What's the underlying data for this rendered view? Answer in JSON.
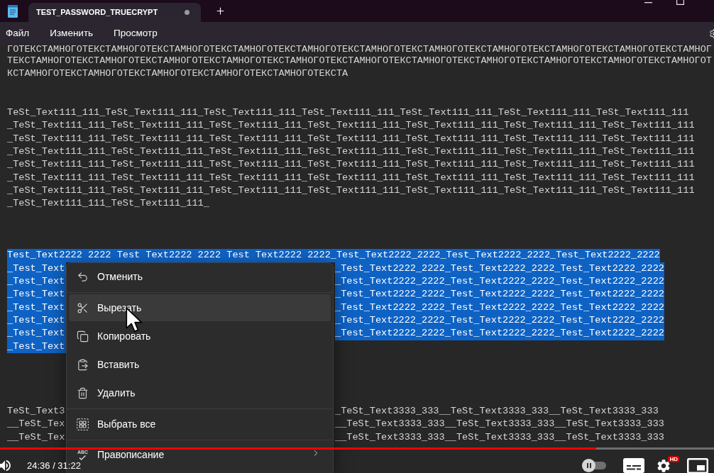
{
  "window": {
    "tab_title": "TEST_PASSWORD_TRUECRYPT",
    "modified": true
  },
  "menu_bar": {
    "items": [
      "Файл",
      "Изменить",
      "Просмотр"
    ]
  },
  "editor": {
    "blocks": [
      {
        "selected": false,
        "lines": [
          {
            "text": "ГОТЕКСТАМНОГОТЕКСТАМНОГОТЕКСТАМНОГОТЕКСТАМНОГОТЕКСТАМНОГОТЕКСТАМНОГОТЕКСТАМНОГОТЕКСТАМНОГОТЕКСТАМНОГОТЕКСТАМНОГОТЕКСТАМНОГ"
          },
          {
            "text": "ТЕКСТАМНОГОТЕКСТАМНОГОТЕКСТАМНОГОТЕКСТАМНОГОТЕКСТАМНОГОТЕКСТАМНОГОТЕКСТАМНОГОТЕКСТАМНОГОТЕКСТАМНОГОТЕКСТАМНОГОТЕКСТАМНОГОТ"
          },
          {
            "text": "КСТАМНОГОТЕКСТАМНОГОТЕКСТАМНОГОТЕКСТАМНОГОТЕКСТАМНОГОТЕКСТА"
          }
        ]
      },
      {
        "selected": false,
        "lines": [
          {
            "text": "TeSt_Text111_111_TeSt_Text111_111_TeSt_Text111_111_TeSt_Text111_111_TeSt_Text111_111_TeSt_Text111_111_TeSt_Text111_111"
          },
          {
            "text": "_TeSt_Text111_111_TeSt_Text111_111_TeSt_Text111_111_TeSt_Text111_111_TeSt_Text111_111_TeSt_Text111_111_TeSt_Text111_111"
          },
          {
            "text": "_TeSt_Text111_111_TeSt_Text111_111_TeSt_Text111_111_TeSt_Text111_111_TeSt_Text111_111_TeSt_Text111_111_TeSt_Text111_111"
          },
          {
            "text": "_TeSt_Text111_111_TeSt_Text111_111_TeSt_Text111_111_TeSt_Text111_111_TeSt_Text111_111_TeSt_Text111_111_TeSt_Text111_111"
          },
          {
            "text": "_TeSt_Text111_111_TeSt_Text111_111_TeSt_Text111_111_TeSt_Text111_111_TeSt_Text111_111_TeSt_Text111_111_TeSt_Text111_111"
          },
          {
            "text": "_TeSt_Text111_111_TeSt_Text111_111_TeSt_Text111_111_TeSt_Text111_111_TeSt_Text111_111_TeSt_Text111_111_TeSt_Text111_111"
          },
          {
            "text": "_TeSt_Text111_111_TeSt_Text111_111_TeSt_Text111_111_TeSt_Text111_111_TeSt_Text111_111_TeSt_Text111_111_TeSt_Text111_111"
          },
          {
            "text": "_TeSt_Text111_111_TeSt_Text111_111_"
          }
        ]
      },
      {
        "selected": true,
        "lines": [
          {
            "text": "Test_Text2222 2222 Test Text2222 2222 Test Text2222 2222_Test_Text2222_2222_Test_Text2222_2222_Test_Text2222_2222"
          },
          {
            "left": "_Test_Text",
            "right": "_Test_Text2222_2222_Test_Text2222_2222_Test_Text2222_2222"
          },
          {
            "left": "_Test_Text",
            "right": "_Test_Text2222_2222_Test_Text2222_2222_Test_Text2222_2222"
          },
          {
            "left": "_Test_Text",
            "right": "_Test_Text2222_2222_Test_Text2222_2222_Test_Text2222_2222"
          },
          {
            "left": "_Test_Text",
            "right": "_Test_Text2222_2222_Test_Text2222_2222_Test_Text2222_2222"
          },
          {
            "left": "_Test_Text",
            "right": "_Test_Text2222_2222_Test_Text2222_2222_Test_Text2222_2222"
          },
          {
            "left": "_Test_Text",
            "right": "_Test_Text2222_2222_Test_Text2222_2222_Test_Text2222_2222"
          },
          {
            "left": "_Test_Text"
          }
        ]
      },
      {
        "selected": false,
        "lines": [
          {
            "left": "TeSt_Text3",
            "right": "_TeSt_Text3333_333__TeSt_Text3333_333__TeSt_Text3333_333"
          },
          {
            "left": "__TeSt_Tex",
            "right": "__TeSt_Text3333_333__TeSt_Text3333_333__TeSt_Text3333_333"
          },
          {
            "left": "__TeSt_Tex",
            "right": "__TeSt_Text3333_333__TeSt_Text3333_333__TeSt_Text3333_333"
          }
        ]
      }
    ]
  },
  "context_menu": {
    "groups": [
      {
        "items": [
          {
            "label": "Отменить",
            "hovered": false,
            "submenu": false
          }
        ]
      },
      {
        "items": [
          {
            "label": "Вырезать",
            "hovered": true,
            "submenu": false
          },
          {
            "label": "Копировать",
            "hovered": false,
            "submenu": false
          },
          {
            "label": "Вставить",
            "hovered": false,
            "submenu": false
          },
          {
            "label": "Удалить",
            "hovered": false,
            "submenu": false
          }
        ]
      },
      {
        "items": [
          {
            "label": "Выбрать все",
            "hovered": false,
            "submenu": false
          }
        ]
      },
      {
        "items": [
          {
            "label": "Правописание",
            "hovered": false,
            "submenu": true,
            "icon_text": "ABC"
          }
        ]
      }
    ]
  },
  "video_player": {
    "progress": {
      "level": 0.835
    },
    "time": "24:36 / 31:22",
    "autoplay_on": false,
    "quality_badge": "HD"
  }
}
